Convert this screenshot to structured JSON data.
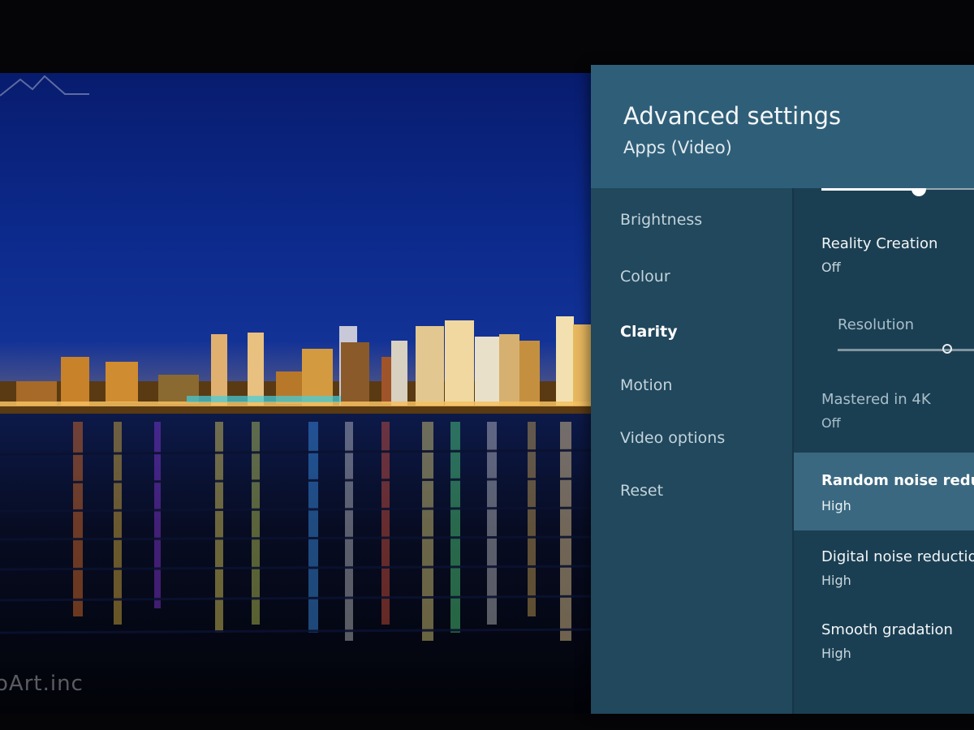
{
  "header": {
    "title": "Advanced settings",
    "subtitle": "Apps (Video)"
  },
  "menu": {
    "items": [
      {
        "label": "Brightness",
        "active": false
      },
      {
        "label": "Colour",
        "active": false
      },
      {
        "label": "Clarity",
        "active": true
      },
      {
        "label": "Motion",
        "active": false
      },
      {
        "label": "Video options",
        "active": false
      },
      {
        "label": "Reset",
        "active": false
      }
    ]
  },
  "detail": {
    "top_slider": {
      "level": 0.6
    },
    "reality_creation": {
      "label": "Reality Creation",
      "value": "Off"
    },
    "resolution": {
      "label": "Resolution",
      "level": 0.75
    },
    "mastered_in_4k": {
      "label": "Mastered in 4K",
      "value": "Off"
    },
    "random_noise_reduction": {
      "label": "Random noise reduction",
      "value": "High"
    },
    "digital_noise_reduction": {
      "label": "Digital noise reduction",
      "value": "High"
    },
    "smooth_gradation": {
      "label": "Smooth gradation",
      "value": "High"
    }
  },
  "wallpaper": {
    "watermark": "oArt.inc"
  },
  "colors": {
    "panel_background": "#1e4458",
    "header_background": "#2f5f78",
    "selected_row": "#3a6880",
    "sky": "#0c2a8c"
  }
}
